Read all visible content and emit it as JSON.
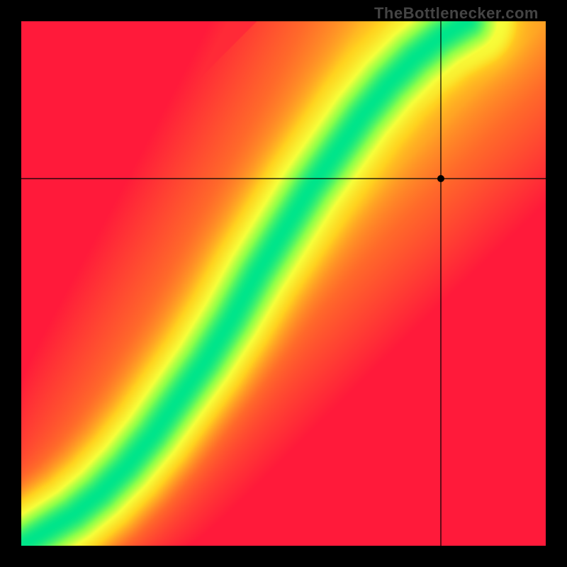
{
  "watermark": "TheBottlenecker.com",
  "chart_data": {
    "type": "heatmap",
    "title": "",
    "xlabel": "",
    "ylabel": "",
    "xlim": [
      0,
      1
    ],
    "ylim": [
      0,
      1
    ],
    "crosshair": {
      "x": 0.8,
      "y": 0.7
    },
    "ridge": {
      "description": "Optimal-balance curve; value peaks (green=1.0) along this path in normalized [0,1] coords, fades toward red with distance.",
      "points": [
        [
          0.0,
          0.0
        ],
        [
          0.05,
          0.03
        ],
        [
          0.1,
          0.06
        ],
        [
          0.15,
          0.1
        ],
        [
          0.2,
          0.15
        ],
        [
          0.25,
          0.21
        ],
        [
          0.3,
          0.28
        ],
        [
          0.35,
          0.35
        ],
        [
          0.4,
          0.43
        ],
        [
          0.45,
          0.52
        ],
        [
          0.5,
          0.6
        ],
        [
          0.55,
          0.68
        ],
        [
          0.6,
          0.75
        ],
        [
          0.65,
          0.82
        ],
        [
          0.7,
          0.88
        ],
        [
          0.75,
          0.93
        ],
        [
          0.8,
          0.97
        ],
        [
          0.85,
          1.0
        ]
      ],
      "half_width": 0.045
    },
    "side_regions": {
      "top_left": "red",
      "bottom_right": "red",
      "top_right": "yellow",
      "along_ridge": "green"
    },
    "colorscale": [
      [
        0.0,
        "#ff1a3a"
      ],
      [
        0.25,
        "#ff6a2a"
      ],
      [
        0.5,
        "#ffd21f"
      ],
      [
        0.7,
        "#f6ff3a"
      ],
      [
        0.85,
        "#8cff4a"
      ],
      [
        1.0,
        "#00e58a"
      ]
    ]
  }
}
